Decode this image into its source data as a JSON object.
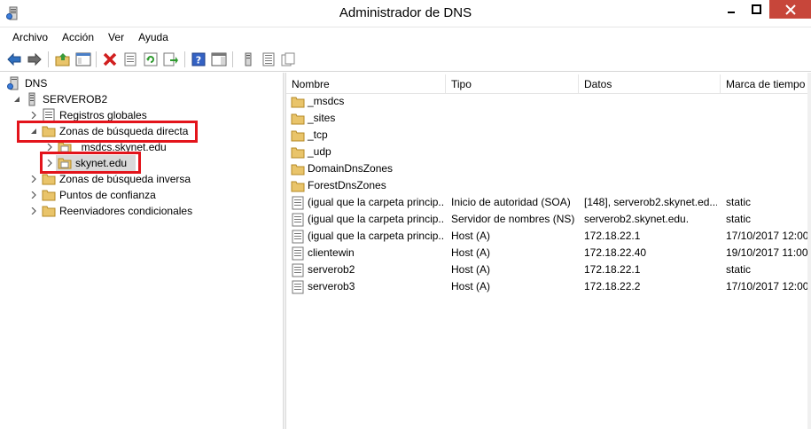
{
  "window": {
    "title": "Administrador de DNS"
  },
  "menu": {
    "items": [
      "Archivo",
      "Acción",
      "Ver",
      "Ayuda"
    ]
  },
  "toolbar": {
    "buttons": [
      "back-icon",
      "forward-icon",
      "up-folder-icon",
      "show-hide-tree-icon",
      "delete-icon",
      "properties-icon",
      "refresh-icon",
      "export-list-icon",
      "help-icon",
      "action-pane-icon",
      "server-icon",
      "list-icon",
      "copy-icon"
    ]
  },
  "tree": {
    "root": "DNS",
    "server": "SERVEROB2",
    "items": {
      "global_logs": "Registros globales",
      "forward_zones": "Zonas de búsqueda directa",
      "msdcs_zone": "_msdcs.skynet.edu",
      "skynet_zone": "skynet.edu",
      "reverse_zones": "Zonas de búsqueda inversa",
      "trust_points": "Puntos de confianza",
      "conditional_forwarders": "Reenviadores condicionales"
    }
  },
  "list": {
    "columns": {
      "name": "Nombre",
      "type": "Tipo",
      "data": "Datos",
      "timestamp": "Marca de tiempo"
    },
    "rows": [
      {
        "name": "_msdcs",
        "type": "",
        "data": "",
        "timestamp": "",
        "icon": "folder-icon"
      },
      {
        "name": "_sites",
        "type": "",
        "data": "",
        "timestamp": "",
        "icon": "folder-icon"
      },
      {
        "name": "_tcp",
        "type": "",
        "data": "",
        "timestamp": "",
        "icon": "folder-icon"
      },
      {
        "name": "_udp",
        "type": "",
        "data": "",
        "timestamp": "",
        "icon": "folder-icon"
      },
      {
        "name": "DomainDnsZones",
        "type": "",
        "data": "",
        "timestamp": "",
        "icon": "folder-icon"
      },
      {
        "name": "ForestDnsZones",
        "type": "",
        "data": "",
        "timestamp": "",
        "icon": "folder-icon"
      },
      {
        "name": "(igual que la carpeta princip...",
        "type": "Inicio de autoridad (SOA)",
        "data": "[148], serverob2.skynet.ed...",
        "timestamp": "static",
        "icon": "record-icon"
      },
      {
        "name": "(igual que la carpeta princip...",
        "type": "Servidor de nombres (NS)",
        "data": "serverob2.skynet.edu.",
        "timestamp": "static",
        "icon": "record-icon"
      },
      {
        "name": "(igual que la carpeta princip...",
        "type": "Host (A)",
        "data": "172.18.22.1",
        "timestamp": "17/10/2017 12:00:",
        "icon": "record-icon"
      },
      {
        "name": "clientewin",
        "type": "Host (A)",
        "data": "172.18.22.40",
        "timestamp": "19/10/2017 11:00:",
        "icon": "record-icon"
      },
      {
        "name": "serverob2",
        "type": "Host (A)",
        "data": "172.18.22.1",
        "timestamp": "static",
        "icon": "record-icon"
      },
      {
        "name": "serverob3",
        "type": "Host (A)",
        "data": "172.18.22.2",
        "timestamp": "17/10/2017 12:00:",
        "icon": "record-icon"
      }
    ]
  },
  "colors": {
    "close_button": "#c7463a",
    "highlight_border": "#e3141b",
    "folder": "#e9c46a",
    "selection": "#d9d9d9"
  }
}
